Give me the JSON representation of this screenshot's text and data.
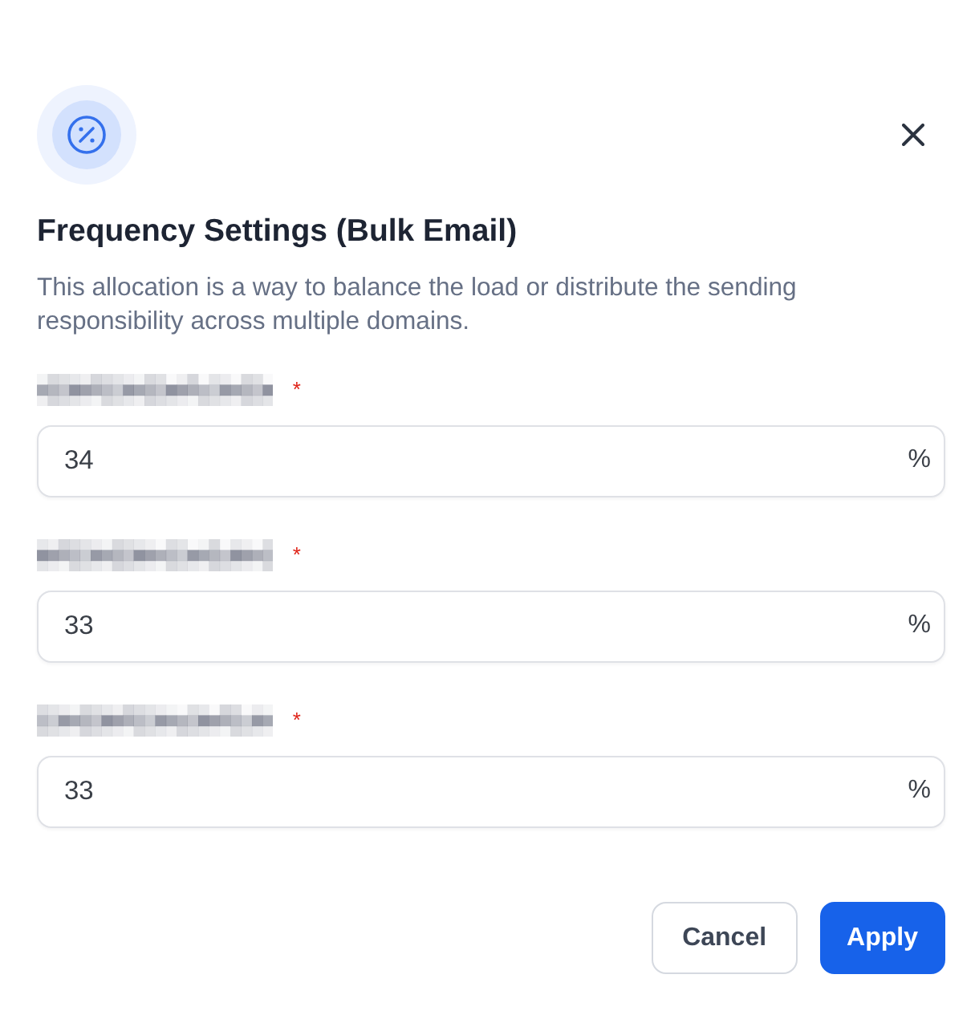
{
  "dialog": {
    "title": "Frequency Settings (Bulk Email)",
    "description": "This allocation is a way to balance the load or distribute the sending responsibility across multiple domains."
  },
  "fields": [
    {
      "label_redacted": true,
      "required_mark": "*",
      "value": "34",
      "suffix": "%"
    },
    {
      "label_redacted": true,
      "required_mark": "*",
      "value": "33",
      "suffix": "%"
    },
    {
      "label_redacted": true,
      "required_mark": "*",
      "value": "33",
      "suffix": "%"
    }
  ],
  "buttons": [
    {
      "label": "Cancel",
      "kind": "secondary"
    },
    {
      "label": "Apply",
      "kind": "primary"
    }
  ]
}
